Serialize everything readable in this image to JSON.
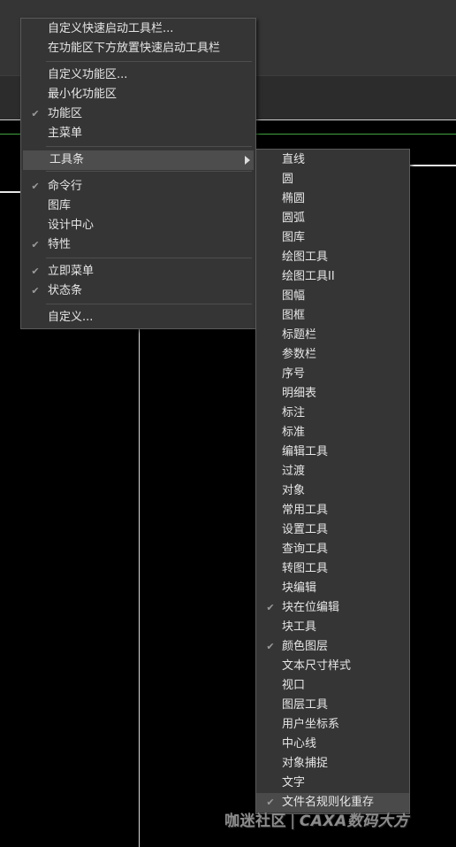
{
  "main_menu": {
    "items": [
      {
        "label": "自定义快速启动工具栏...",
        "checked": false
      },
      {
        "label": "在功能区下方放置快速启动工具栏",
        "checked": false
      },
      {
        "label": "自定义功能区...",
        "checked": false
      },
      {
        "label": "最小化功能区",
        "checked": false
      },
      {
        "label": "功能区",
        "checked": true
      },
      {
        "label": "主菜单",
        "checked": false
      },
      {
        "label": "工具条",
        "checked": false,
        "has_submenu": true,
        "highlighted": true
      },
      {
        "label": "命令行",
        "checked": true
      },
      {
        "label": "图库",
        "checked": false
      },
      {
        "label": "设计中心",
        "checked": false
      },
      {
        "label": "特性",
        "checked": true
      },
      {
        "label": "立即菜单",
        "checked": true
      },
      {
        "label": "状态条",
        "checked": true
      },
      {
        "label": "自定义...",
        "checked": false
      }
    ]
  },
  "toolbar_submenu": {
    "items": [
      {
        "label": "直线",
        "checked": false
      },
      {
        "label": "圆",
        "checked": false
      },
      {
        "label": "椭圆",
        "checked": false
      },
      {
        "label": "圆弧",
        "checked": false
      },
      {
        "label": "图库",
        "checked": false
      },
      {
        "label": "绘图工具",
        "checked": false
      },
      {
        "label": "绘图工具II",
        "checked": false
      },
      {
        "label": "图幅",
        "checked": false
      },
      {
        "label": "图框",
        "checked": false
      },
      {
        "label": "标题栏",
        "checked": false
      },
      {
        "label": "参数栏",
        "checked": false
      },
      {
        "label": "序号",
        "checked": false
      },
      {
        "label": "明细表",
        "checked": false
      },
      {
        "label": "标注",
        "checked": false
      },
      {
        "label": "标准",
        "checked": false
      },
      {
        "label": "编辑工具",
        "checked": false
      },
      {
        "label": "过渡",
        "checked": false
      },
      {
        "label": "对象",
        "checked": false
      },
      {
        "label": "常用工具",
        "checked": false
      },
      {
        "label": "设置工具",
        "checked": false
      },
      {
        "label": "查询工具",
        "checked": false
      },
      {
        "label": "转图工具",
        "checked": false
      },
      {
        "label": "块编辑",
        "checked": false
      },
      {
        "label": "块在位编辑",
        "checked": true
      },
      {
        "label": "块工具",
        "checked": false
      },
      {
        "label": "颜色图层",
        "checked": true
      },
      {
        "label": "文本尺寸样式",
        "checked": false
      },
      {
        "label": "视口",
        "checked": false
      },
      {
        "label": "图层工具",
        "checked": false
      },
      {
        "label": "用户坐标系",
        "checked": false
      },
      {
        "label": "中心线",
        "checked": false
      },
      {
        "label": "对象捕捉",
        "checked": false
      },
      {
        "label": "文字",
        "checked": false
      },
      {
        "label": "文件名规则化重存",
        "checked": true
      }
    ]
  },
  "watermark": {
    "left": "咖迷社区",
    "divider": "|",
    "right": "CAXA数码大方"
  },
  "colors": {
    "menu_bg": "#353535",
    "highlight": "#4d4d4d",
    "text": "#e6e6e6",
    "check": "#9a9a9a"
  },
  "icons": {
    "check": "check-icon",
    "submenu_arrow": "triangle-right-icon"
  }
}
